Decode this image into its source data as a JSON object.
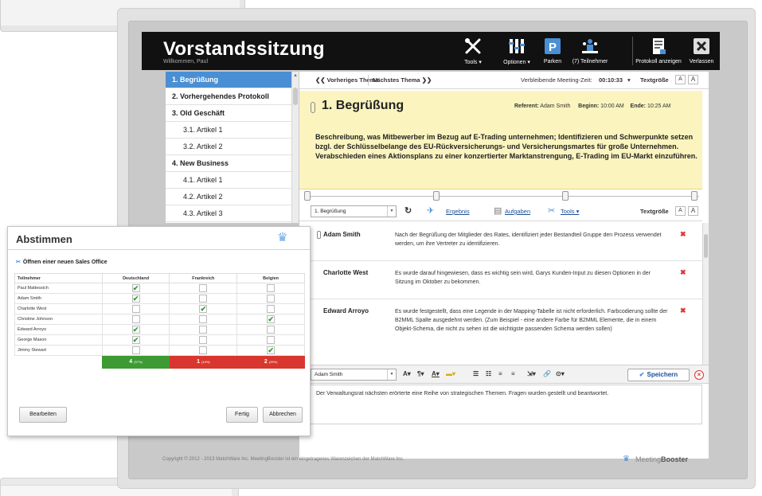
{
  "header": {
    "title": "Vorstandssitzung",
    "subtitle": "Willkommen, Paul",
    "buttons": [
      {
        "label": "Tools ▾",
        "icon": "tools-icon"
      },
      {
        "label": "Optionen ▾",
        "icon": "options-icon"
      },
      {
        "label": "Parken",
        "icon": "parking-icon"
      },
      {
        "label": "(7) Teilnehmer",
        "icon": "participants-icon"
      },
      {
        "label": "Protokoll anzeigen",
        "icon": "protocol-icon"
      },
      {
        "label": "Verlassen",
        "icon": "close-icon"
      }
    ]
  },
  "sidebar": {
    "items": [
      {
        "label": "1. Begrüßung"
      },
      {
        "label": "2. Vorhergehendes Protokoll"
      },
      {
        "label": "3. Old Geschäft"
      },
      {
        "label": "3.1. Artikel 1"
      },
      {
        "label": "3.2. Artikel 2"
      },
      {
        "label": "4. New Business"
      },
      {
        "label": "4.1. Artikel 1"
      },
      {
        "label": "4.2. Artikel 2"
      },
      {
        "label": "4.3. Artikel 3"
      }
    ]
  },
  "topnav": {
    "prev": "❮❮ Vorheriges Thema",
    "next": "Nächstes Thema ❯❯",
    "time_label": "Verbleibende Meeting-Zeit:",
    "time_value": "00:10:33",
    "text_size": "Textgröße",
    "size_small": "A",
    "size_large": "A"
  },
  "topic": {
    "title": "1. Begrüßung",
    "referent_label": "Referent:",
    "referent": "Adam Smith",
    "start_label": "Beginn:",
    "start": "10:00 AM",
    "end_label": "Ende:",
    "end": "10:25 AM",
    "description": "Beschreibung, was Mitbewerber im Bezug auf E-Trading unternehmen; Identifizieren und Schwerpunkte setzen bzgl. der Schlüsselbelange des EU-Rückversicherungs- und Versicherungsmartes für große Unternehmen. Verabschieden eines Aktionsplans zu einer konzertierter Marktanstrengung, E-Trading im EU-Markt einzuführen."
  },
  "toolbar2": {
    "topic_select": "1. Begrüßung",
    "ergebnis": "Ergebnis",
    "aufgaben": "Aufgaben",
    "tools": "Tools ▾",
    "text_size": "Textgröße",
    "size_small": "A",
    "size_large": "A"
  },
  "notes": [
    {
      "author": "Adam Smith",
      "text": "Nach der Begrüßung der Mitglieder des Rates, identifiziert jeder Bestandteil Gruppe den Prozess verwendet werden, um ihre Vertreter zu identifizieren."
    },
    {
      "author": "Charlotte West",
      "text": "Es wurde darauf hingewiesen, dass es wichtig sein wird, Garys Kunden-Input zu diesen Optionen in der Sitzung im Oktober zu bekommen."
    },
    {
      "author": "Edward Arroyo",
      "text": "Es wurde festgestellt, dass eine Legende in der Mapping-Tabelle ist nicht erforderlich. Farbcodierung sollte der B2MML Spalte ausgedehnt werden. (Zum Beispiel - eine andere Farbe für B2MML Elemente, die in einem Objekt-Schema, die nicht zu sehen ist die wichtigste passenden Schema werden sollen)"
    }
  ],
  "editor": {
    "author_select": "Adam Smith",
    "save_label": "Speichern",
    "text": "Der Verwaltungsrat nächsten erörterte eine Reihe von strategischen Themen. Fragen wurden gestellt und beantwortet."
  },
  "footer": {
    "copyright": "Copyright © 2012 - 2013 MatchWare Inc.    MeetingBooster ist ein eingetragenes Warenzeichen der MatchWare Inc.",
    "brand_light": "Meeting",
    "brand_bold": "Booster"
  },
  "vote": {
    "title": "Abstimmen",
    "question": "Öffnen einer neuen Sales Office",
    "columns": [
      "Teilnehmer",
      "Deutschland",
      "Frankreich",
      "Belgien"
    ],
    "rows": [
      {
        "name": "Paul Mattessich",
        "votes": [
          true,
          false,
          false
        ]
      },
      {
        "name": "Adam Smith",
        "votes": [
          true,
          false,
          false
        ]
      },
      {
        "name": "Charlotte West",
        "votes": [
          false,
          true,
          false
        ]
      },
      {
        "name": "Christine Johnson",
        "votes": [
          false,
          false,
          true
        ]
      },
      {
        "name": "Edward Arroyo",
        "votes": [
          true,
          false,
          false
        ]
      },
      {
        "name": "George Mason",
        "votes": [
          true,
          false,
          false
        ]
      },
      {
        "name": "Jimmy Stewart",
        "votes": [
          false,
          false,
          true
        ]
      }
    ],
    "results": [
      {
        "count": "4",
        "pct": "(57%)",
        "color": "#3e9a33"
      },
      {
        "count": "1",
        "pct": "(14%)",
        "color": "#d8362e"
      },
      {
        "count": "2",
        "pct": "(29%)",
        "color": "#d8362e"
      }
    ],
    "edit_label": "Bearbeiten",
    "done_label": "Fertig",
    "cancel_label": "Abbrechen"
  }
}
